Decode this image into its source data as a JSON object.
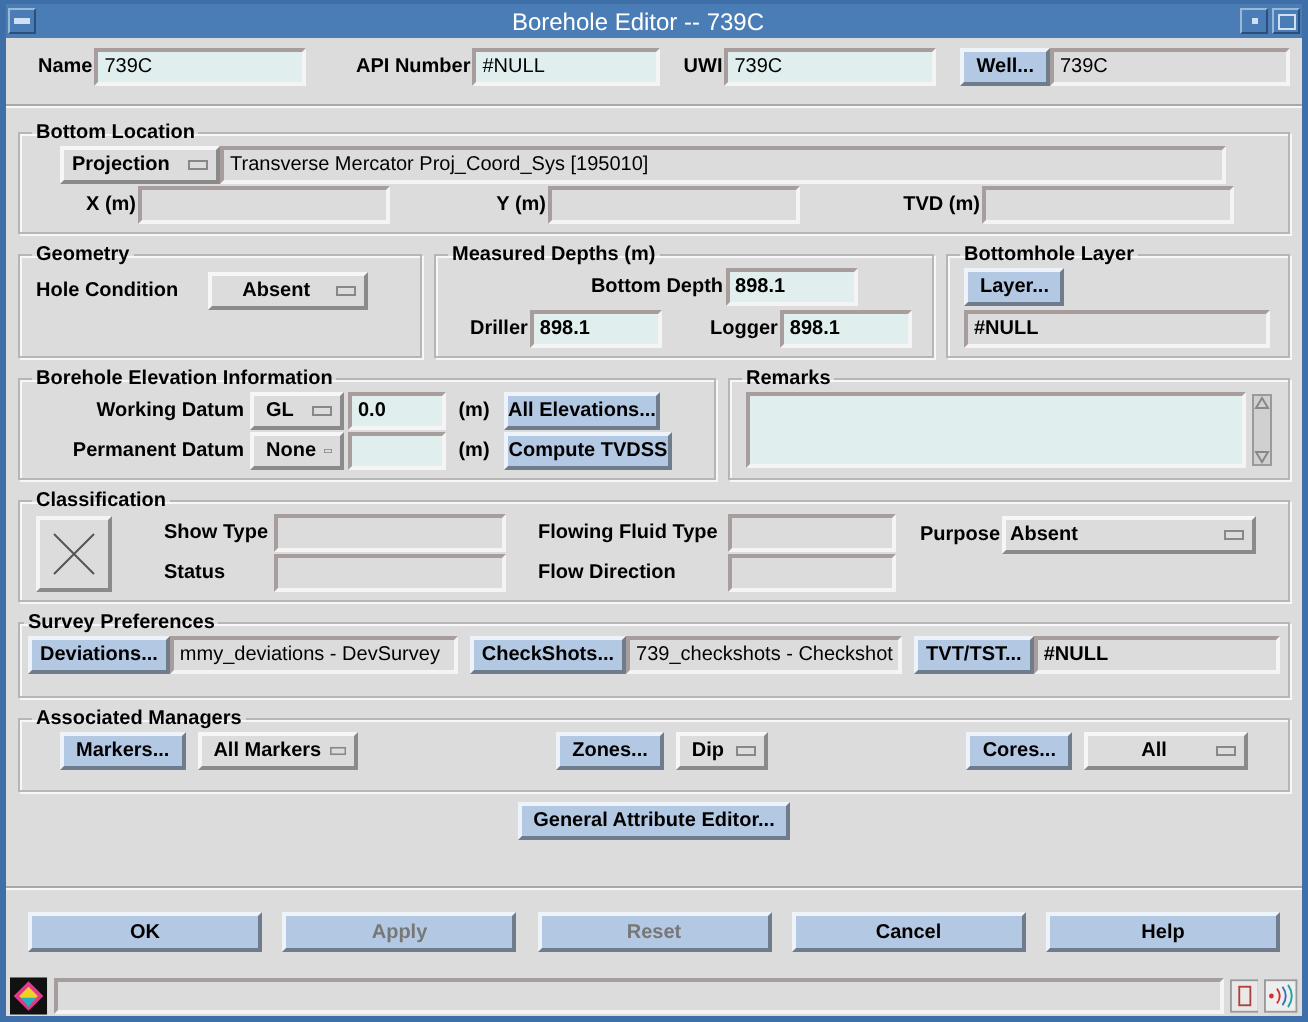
{
  "window": {
    "title": "Borehole Editor -- 739C"
  },
  "header": {
    "name": {
      "label": "Name",
      "value": "739C"
    },
    "api_number": {
      "label": "API Number",
      "value": "#NULL"
    },
    "uwi": {
      "label": "UWI",
      "value": "739C"
    },
    "well": {
      "button": "Well...",
      "value": "739C"
    }
  },
  "bottom_location": {
    "title": "Bottom Location",
    "projection": {
      "label": "Projection",
      "value": "Transverse Mercator Proj_Coord_Sys [195010]"
    },
    "x": {
      "label": "X (m)"
    },
    "y": {
      "label": "Y (m)"
    },
    "tvd": {
      "label": "TVD (m)"
    }
  },
  "geometry": {
    "title": "Geometry",
    "hole_condition": {
      "label": "Hole Condition",
      "value": "Absent"
    }
  },
  "measured_depths": {
    "title": "Measured Depths (m)",
    "bottom_depth": {
      "label": "Bottom Depth",
      "value": "898.1"
    },
    "driller": {
      "label": "Driller",
      "value": "898.1"
    },
    "logger": {
      "label": "Logger",
      "value": "898.1"
    }
  },
  "bottomhole_layer": {
    "title": "Bottomhole Layer",
    "button": "Layer...",
    "value": "#NULL"
  },
  "elevation": {
    "title": "Borehole Elevation Information",
    "working_datum": {
      "label": "Working Datum",
      "option": "GL",
      "value": "0.0",
      "unit": "(m)"
    },
    "permanent_datum": {
      "label": "Permanent Datum",
      "option": "None",
      "unit": "(m)"
    },
    "buttons": [
      "All Elevations...",
      "Compute TVDSS"
    ]
  },
  "remarks": {
    "title": "Remarks"
  },
  "classification": {
    "title": "Classification",
    "show_type": {
      "label": "Show Type"
    },
    "status": {
      "label": "Status"
    },
    "flowing_fluid_type": {
      "label": "Flowing Fluid Type"
    },
    "flow_direction": {
      "label": "Flow Direction"
    },
    "purpose": {
      "label": "Purpose",
      "value": "Absent"
    }
  },
  "survey_preferences": {
    "title": "Survey Preferences",
    "items": [
      {
        "button": "Deviations...",
        "value": "mmy_deviations - DevSurvey"
      },
      {
        "button": "CheckShots...",
        "value": "739_checkshots - Checkshot"
      },
      {
        "button": "TVT/TST...",
        "value": "#NULL"
      }
    ]
  },
  "associated_managers": {
    "title": "Associated Managers",
    "markers": {
      "button": "Markers...",
      "option": "All Markers"
    },
    "zones": {
      "button": "Zones...",
      "option": "Dip"
    },
    "cores": {
      "button": "Cores...",
      "option": "All"
    },
    "general_button": "General Attribute Editor..."
  },
  "buttons": [
    {
      "label": "OK",
      "disabled": false
    },
    {
      "label": "Apply",
      "disabled": true
    },
    {
      "label": "Reset",
      "disabled": true
    },
    {
      "label": "Cancel",
      "disabled": false
    },
    {
      "label": "Help",
      "disabled": false
    }
  ]
}
